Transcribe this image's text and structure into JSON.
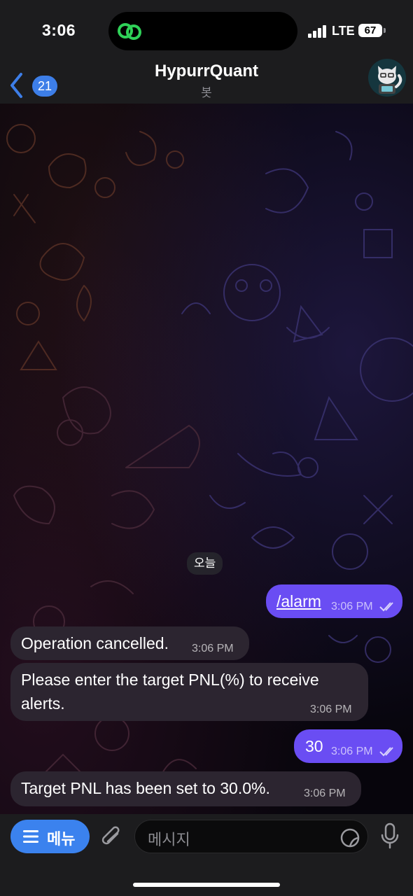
{
  "status_bar": {
    "time": "3:06",
    "network": "LTE",
    "battery": "67"
  },
  "header": {
    "back_count": "21",
    "title": "HypurrQuant",
    "subtitle": "봇"
  },
  "date_separator": "오늘",
  "messages": [
    {
      "direction": "out",
      "text": "/alarm",
      "time": "3:06 PM",
      "read": true
    },
    {
      "direction": "in",
      "text": "Operation cancelled.",
      "time": "3:06 PM"
    },
    {
      "direction": "in",
      "text": "Please enter the target PNL(%) to receive alerts.",
      "time": "3:06 PM"
    },
    {
      "direction": "out",
      "text": "30",
      "time": "3:06 PM",
      "read": true
    },
    {
      "direction": "in",
      "text": "Target PNL has been set to 30.0%.",
      "time": "3:06 PM"
    }
  ],
  "composer": {
    "menu_label": "메뉴",
    "placeholder": "메시지"
  },
  "colors": {
    "accent": "#3b82ee",
    "outgoing_bubble": "#6a4df3",
    "incoming_bubble": "#2c2530"
  }
}
